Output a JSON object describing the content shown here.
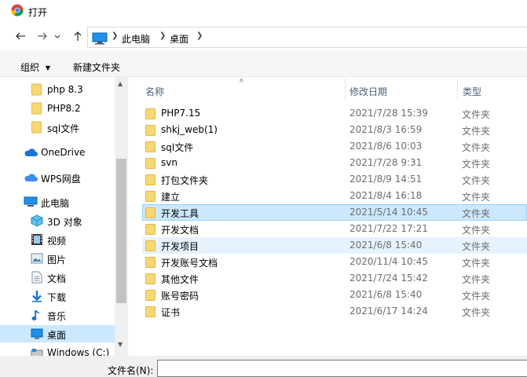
{
  "window": {
    "title": "打开"
  },
  "address": {
    "crumbs": [
      "此电脑",
      "桌面"
    ]
  },
  "toolbar": {
    "organize": "组织",
    "new_folder": "新建文件夹"
  },
  "nav": {
    "items": [
      {
        "label": "php 8.3",
        "icon": "folder-icon"
      },
      {
        "label": "PHP8.2",
        "icon": "folder-icon"
      },
      {
        "label": "sql文件",
        "icon": "folder-icon"
      },
      {
        "label": "OneDrive",
        "icon": "cloud-icon"
      },
      {
        "label": "WPS网盘",
        "icon": "cloud-icon"
      },
      {
        "label": "此电脑",
        "icon": "computer-icon"
      },
      {
        "label": "3D 对象",
        "icon": "cube-icon"
      },
      {
        "label": "视频",
        "icon": "video-icon"
      },
      {
        "label": "图片",
        "icon": "picture-icon"
      },
      {
        "label": "文档",
        "icon": "document-icon"
      },
      {
        "label": "下载",
        "icon": "download-icon"
      },
      {
        "label": "音乐",
        "icon": "music-icon"
      },
      {
        "label": "桌面",
        "icon": "desktop-icon"
      },
      {
        "label": "Windows (C:)",
        "icon": "drive-icon"
      }
    ]
  },
  "list": {
    "headers": {
      "name": "名称",
      "date": "修改日期",
      "type": "类型"
    },
    "rows": [
      {
        "name": "PHP7.15",
        "date": "2021/7/28 15:39",
        "type": "文件夹"
      },
      {
        "name": "shkj_web(1)",
        "date": "2021/8/3 16:59",
        "type": "文件夹"
      },
      {
        "name": "sql文件",
        "date": "2021/8/6 10:03",
        "type": "文件夹"
      },
      {
        "name": "svn",
        "date": "2021/7/28 9:31",
        "type": "文件夹"
      },
      {
        "name": "打包文件夹",
        "date": "2021/8/9 14:51",
        "type": "文件夹"
      },
      {
        "name": "建立",
        "date": "2021/8/4 16:18",
        "type": "文件夹"
      },
      {
        "name": "开发工具",
        "date": "2021/5/14 10:45",
        "type": "文件夹"
      },
      {
        "name": "开发文档",
        "date": "2021/7/22 17:21",
        "type": "文件夹"
      },
      {
        "name": "开发项目",
        "date": "2021/6/8 15:40",
        "type": "文件夹"
      },
      {
        "name": "开发账号文档",
        "date": "2020/11/4 10:45",
        "type": "文件夹"
      },
      {
        "name": "其他文件",
        "date": "2021/7/24 15:42",
        "type": "文件夹"
      },
      {
        "name": "账号密码",
        "date": "2021/6/8 15:40",
        "type": "文件夹"
      },
      {
        "name": "证书",
        "date": "2021/6/17 14:24",
        "type": "文件夹"
      }
    ]
  },
  "footer": {
    "filename_label": "文件名(N):",
    "filename_value": ""
  },
  "colors": {
    "selected": "#cce8ff",
    "hover": "#e5f3ff",
    "folder": "#f8d775",
    "accent": "#0078d7"
  }
}
